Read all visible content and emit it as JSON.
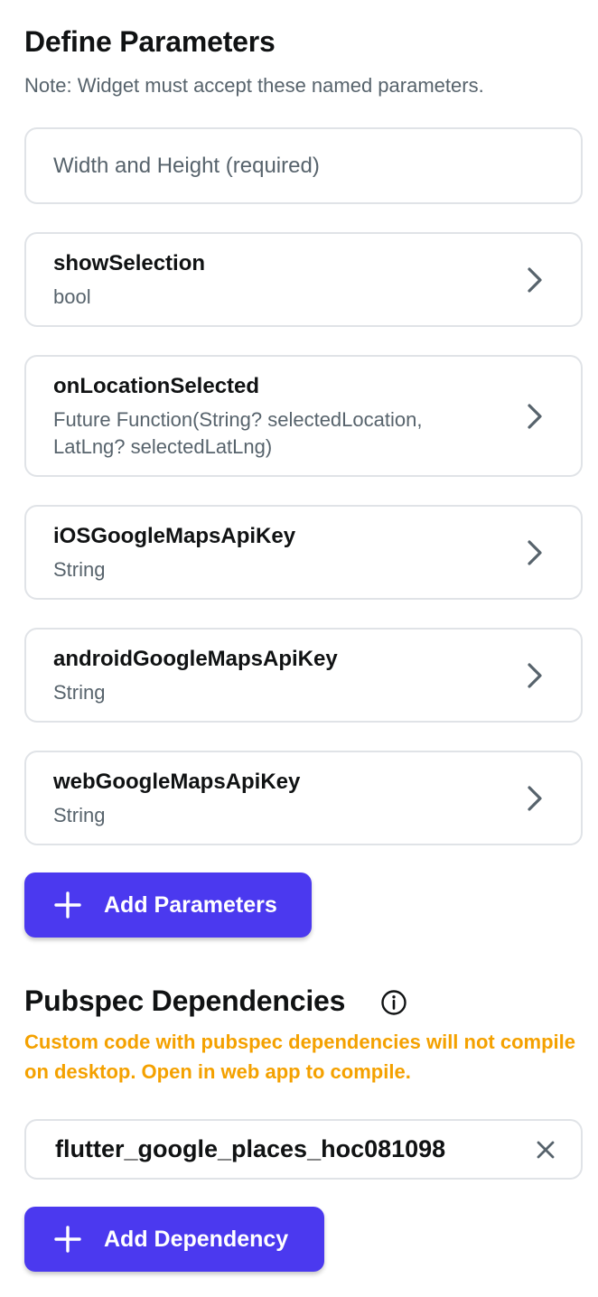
{
  "parameters_section": {
    "title": "Define Parameters",
    "note": "Note: Widget must accept these named parameters.",
    "width_height_placeholder": "Width and Height (required)",
    "items": [
      {
        "name": "showSelection",
        "type": "bool"
      },
      {
        "name": "onLocationSelected",
        "type": "Future Function(String? selectedLocation, LatLng? selectedLatLng)"
      },
      {
        "name": "iOSGoogleMapsApiKey",
        "type": "String"
      },
      {
        "name": "androidGoogleMapsApiKey",
        "type": "String"
      },
      {
        "name": "webGoogleMapsApiKey",
        "type": "String"
      }
    ],
    "add_button_label": "Add Parameters"
  },
  "dependencies_section": {
    "title": "Pubspec Dependencies",
    "warning": "Custom code with pubspec dependencies will not compile on desktop. Open in web app to compile.",
    "items": [
      {
        "name": "flutter_google_places_hoc081098"
      }
    ],
    "add_button_label": "Add Dependency"
  },
  "icons": {
    "chevron": "chevron-right-icon",
    "add": "plus-icon",
    "info": "info-icon",
    "remove": "close-icon"
  },
  "colors": {
    "primary": "#4b39ef",
    "warning": "#f4a100",
    "text_primary": "#101213",
    "text_secondary": "#57636c",
    "border": "#e0e3e7"
  }
}
